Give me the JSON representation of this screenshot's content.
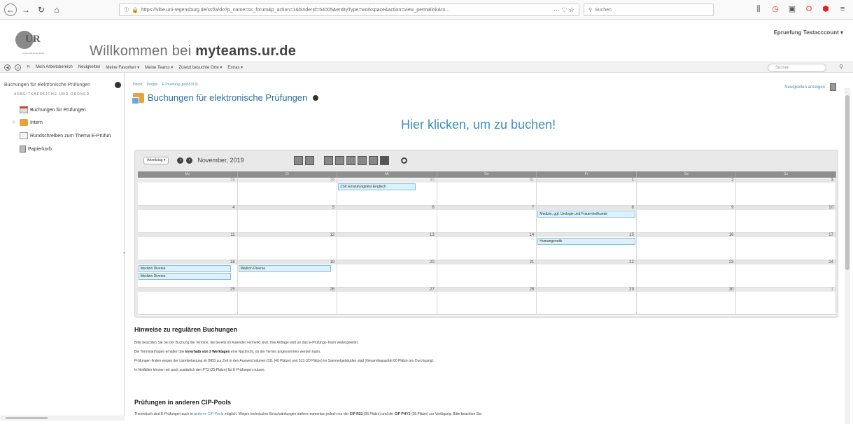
{
  "browser": {
    "url": "https://vibe.uni-regensburg.de/ssf/a/do?p_name=ss_forum&p_action=1&binderId=54005&entityType=workspace&action=view_permalink&ro...",
    "url_actions": "··· ♡ ☆",
    "search_placeholder": "Suchen",
    "toolbar_icons": [
      "library-icon",
      "pocket-icon",
      "sidebar-icon",
      "opera-icon",
      "adblock-icon",
      "menu-icon"
    ]
  },
  "header": {
    "logo_sub": "Universität Regensburg",
    "welcome_prefix": "Willkommen bei ",
    "welcome_brand": "myteams.ur.de",
    "user": "Epruefung Testacccount ▾"
  },
  "menubar": {
    "items": [
      "Mein Arbeitsbereich",
      "Neuigkeiten",
      "Meine Favoriten ▾",
      "Meine Teams ▾",
      "Zuletzt besuchte Orte ▾",
      "Extras ▾"
    ],
    "search_placeholder": "Suchen"
  },
  "sidebar": {
    "title": "Buchungen für elektronische Prüfungen",
    "section": "ARBEITSBEREICHE UND ORDNER",
    "items": [
      {
        "label": "Buchungen für Prüfungen"
      },
      {
        "label": "Intern"
      },
      {
        "label": "Rundschreiben zum Thema E-Prüfun"
      },
      {
        "label": "Papierkorb"
      }
    ]
  },
  "main": {
    "breadcrumb": [
      "Home",
      "People",
      "E Pruefung (pre65313)"
    ],
    "title": "Buchungen für elektronische Prüfungen",
    "news_link": "Neuigkeiten anzeigen",
    "book_link": "Hier klicken, um zu buchen!"
  },
  "calendar": {
    "view": "Arbeitstag ▾",
    "month": "November, 2019",
    "weekdays": [
      "Mo",
      "Di",
      "Mi",
      "Do",
      "Fr",
      "Sa",
      "So"
    ],
    "weeks": [
      [
        "28",
        "29",
        "30",
        "31",
        "1",
        "2",
        "3"
      ],
      [
        "4",
        "5",
        "6",
        "7",
        "8",
        "9",
        "10"
      ],
      [
        "11",
        "12",
        "13",
        "14",
        "15",
        "16",
        "17"
      ],
      [
        "18",
        "19",
        "20",
        "21",
        "22",
        "23",
        "24"
      ],
      [
        "25",
        "26",
        "27",
        "28",
        "29",
        "30",
        "1"
      ]
    ],
    "events": [
      {
        "label": "ZSK Einstufungstest Englisch"
      },
      {
        "label": "Medizin, ggf. Urologie und Frauenheilkunde"
      },
      {
        "label": "Humangenetik"
      },
      {
        "label": "Medizin Diverse"
      },
      {
        "label": "Medizin Diverse"
      },
      {
        "label": "Medizin Diverse"
      }
    ]
  },
  "notes": {
    "heading": "Hinweise zu regulären Buchungen",
    "line1": "Bitte beachten Sie bei der Buchung die Termine, die bereits im Kalender vermerkt sind. Ihre Anfrage wird an das E-Prüfungs-Team weitergeleitet.",
    "line2_pre": "Bei Terminanfragen erhalten Sie ",
    "line2_bold": "innerhalb von 3 Werktagen",
    "line2_post": " eine Nachricht, ob der Termin angenommen werden kann.",
    "line3": "Prüfungen finden wegen der Lärmbelastung im BtB3 zur Zeit in den Ausweichräumen 511 (40 Plätze) und 513 (20 Plätze) im Sammelgebäuden statt (Gesamtkapazität 60 Plätze pro Durchgang).",
    "line4": "In Notfällen können wir auch zusätzlich den PT3 (25 Plätze) für E-Prüfungen nutzen."
  },
  "notes2": {
    "heading": "Prüfungen in anderen CIP-Pools",
    "pre": "Theoretisch sind E-Prüfungen auch in ",
    "link": "anderen CIP-Pools",
    "mid": " möglich. Wegen technischer Einschränkungen stehen momentan jedoch nur der ",
    "b1": "CIP R21",
    "mid2": " (26 Plätze) und der ",
    "b2": "CIP PHY1",
    "post": " (28 Plätze) zur Verfügung. Bitte beachten Sie:"
  }
}
